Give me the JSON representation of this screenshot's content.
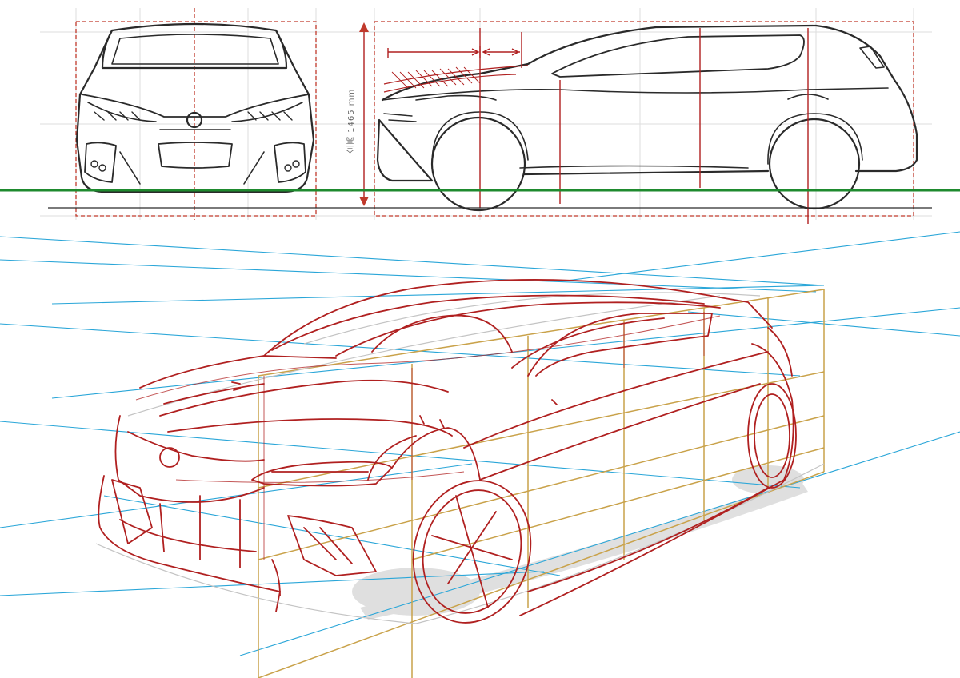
{
  "drawing": {
    "height_dimension_label": "全高 1465 mm"
  },
  "colors": {
    "ink": "#2a2a2a",
    "red_construction": "#b02020",
    "red_dashed": "#c0392b",
    "ground_line": "#1e8a2e",
    "perspective_lines": "#2aa6d8",
    "box_lines": "#c9a24a",
    "grid_lines": "#dddddd",
    "shadow": "#d8d8d8"
  }
}
